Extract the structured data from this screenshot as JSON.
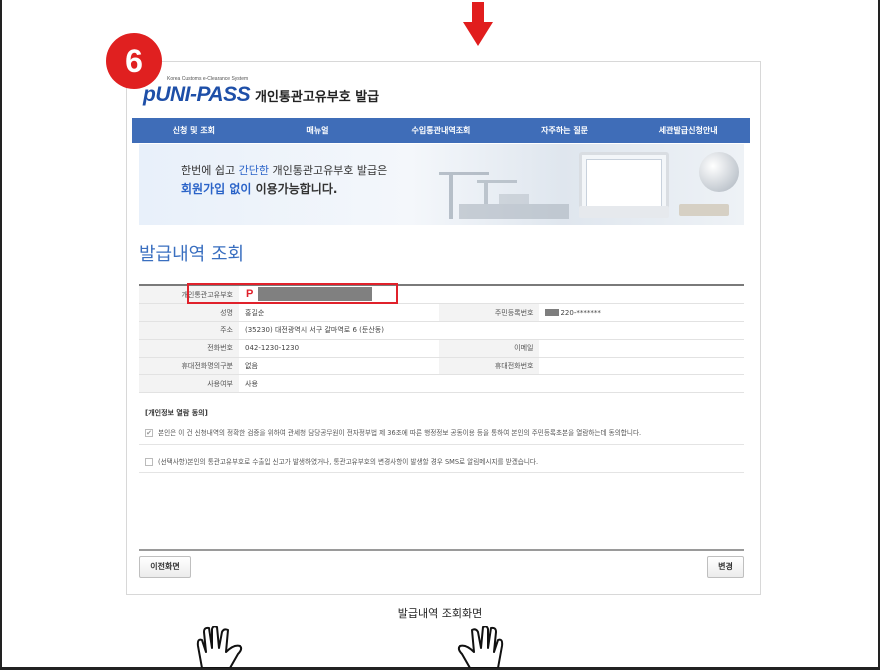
{
  "step_number": "6",
  "logo": {
    "tagline": "Korea Customs e-Clearance System",
    "name": "UNI-PASS",
    "service_title": "개인통관고유부호 발급"
  },
  "nav": {
    "items": [
      "신청 및 조회",
      "매뉴얼",
      "수입통관내역조회",
      "자주하는 질문",
      "세관발급신청안내"
    ]
  },
  "banner": {
    "line1_a": "한번에 쉽고 ",
    "line1_b": "간단한",
    "line1_c": " 개인통관고유부호 발급은",
    "line2_a": "회원가입 없이",
    "line2_b": " 이용가능합니다."
  },
  "page_title": "발급내역 조회",
  "info": {
    "code_label": "개인통관고유부호",
    "code_prefix": "P",
    "name_label": "성명",
    "name_value": "홍길순",
    "rrn_label": "주민등록번호",
    "rrn_value": "220-*******",
    "address_label": "주소",
    "address_value": "(35230)  대전광역시 서구 갈마역로 6 (둔산동)",
    "phone_label": "전화번호",
    "phone_value": "042-1230-1230",
    "email_label": "이메일",
    "email_value": "",
    "mobile_type_label": "휴대전화명의구분",
    "mobile_type_value": "없음",
    "mobile_label": "휴대전화번호",
    "mobile_value": "",
    "use_label": "사용여부",
    "use_value": "사용"
  },
  "consent": {
    "heading": "[개인정보 열람 동의]",
    "item1": "본인은 이 건 신청내역의 정확한 검증을 위하여 관세청 담당공무원이 전자정부법 제 36조에 따른 행정정보 공동이용 등을 통하여 본인의 주민등록초본을 열람하는데 동의합니다.",
    "item2": "(선택사항)본인의 통관고유부호로 수출입 신고가 발생하였거나, 통관고유부호의 변경사항이 발생할 경우 SMS로 알림메시지를 받겠습니다."
  },
  "buttons": {
    "prev": "이전화면",
    "change": "변경"
  },
  "caption": "발급내역 조회화면",
  "colors": {
    "accent_blue": "#3f6db8",
    "badge_red": "#e02020",
    "highlight_red": "#e0212b"
  }
}
